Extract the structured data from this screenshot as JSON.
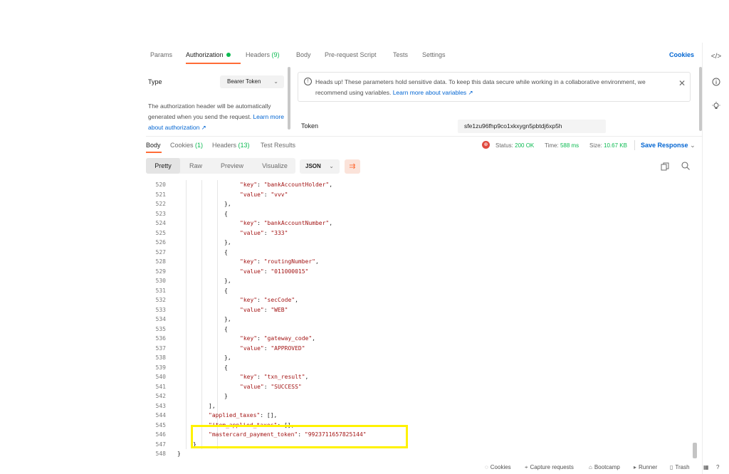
{
  "request_tabs": {
    "params": "Params",
    "authorization": "Authorization",
    "headers": "Headers",
    "headers_count": "(9)",
    "body": "Body",
    "pre_request": "Pre-request Script",
    "tests": "Tests",
    "settings": "Settings",
    "cookies": "Cookies"
  },
  "auth": {
    "type_label": "Type",
    "type_value": "Bearer Token",
    "description": "The authorization header will be automatically generated when you send the request.",
    "learn_more": "Learn more about authorization ↗",
    "banner_text": "Heads up! These parameters hold sensitive data. To keep this data secure while working in a collaborative environment, we recommend using variables.",
    "banner_link": "Learn more about variables ↗",
    "token_label": "Token",
    "token_value": "sfe1zu96fhp9co1xkxygn5pbtdj6xp5h"
  },
  "response_tabs": {
    "body": "Body",
    "cookies": "Cookies",
    "cookies_count": "(1)",
    "headers": "Headers",
    "headers_count": "(13)",
    "test_results": "Test Results"
  },
  "response_stats": {
    "status_label": "Status:",
    "status_value": "200 OK",
    "time_label": "Time:",
    "time_value": "588 ms",
    "size_label": "Size:",
    "size_value": "10.67 KB",
    "save_response": "Save Response"
  },
  "format": {
    "pretty": "Pretty",
    "raw": "Raw",
    "preview": "Preview",
    "visualize": "Visualize",
    "json": "JSON"
  },
  "code_lines": [
    {
      "n": "520",
      "text": "\"key\": \"bankAccountHolder\","
    },
    {
      "n": "521",
      "text": "\"value\": \"vvv\""
    },
    {
      "n": "522",
      "text": "},"
    },
    {
      "n": "523",
      "text": "{"
    },
    {
      "n": "524",
      "text": "\"key\": \"bankAccountNumber\","
    },
    {
      "n": "525",
      "text": "\"value\": \"333\""
    },
    {
      "n": "526",
      "text": "},"
    },
    {
      "n": "527",
      "text": "{"
    },
    {
      "n": "528",
      "text": "\"key\": \"routingNumber\","
    },
    {
      "n": "529",
      "text": "\"value\": \"011000015\""
    },
    {
      "n": "530",
      "text": "},"
    },
    {
      "n": "531",
      "text": "{"
    },
    {
      "n": "532",
      "text": "\"key\": \"secCode\","
    },
    {
      "n": "533",
      "text": "\"value\": \"WEB\""
    },
    {
      "n": "534",
      "text": "},"
    },
    {
      "n": "535",
      "text": "{"
    },
    {
      "n": "536",
      "text": "\"key\": \"gateway_code\","
    },
    {
      "n": "537",
      "text": "\"value\": \"APPROVED\""
    },
    {
      "n": "538",
      "text": "},"
    },
    {
      "n": "539",
      "text": "{"
    },
    {
      "n": "540",
      "text": "\"key\": \"txn_result\","
    },
    {
      "n": "541",
      "text": "\"value\": \"SUCCESS\""
    },
    {
      "n": "542",
      "text": "}"
    },
    {
      "n": "543",
      "text": "],"
    },
    {
      "n": "544",
      "text": "\"applied_taxes\": [],"
    },
    {
      "n": "545",
      "text": "\"item_applied_taxes\": [],"
    },
    {
      "n": "546",
      "text": "\"mastercard_payment_token\": \"9923711657825144\""
    },
    {
      "n": "547",
      "text": "}"
    },
    {
      "n": "548",
      "text": "}"
    }
  ],
  "statusbar": {
    "cookies": "Cookies",
    "capture": "Capture requests",
    "bootcamp": "Bootcamp",
    "runner": "Runner",
    "trash": "Trash"
  },
  "colors": {
    "accent": "#ff6c37",
    "link": "#0265d2",
    "success": "#0cbb52",
    "json_string": "#a31515",
    "highlight": "#fff200"
  }
}
